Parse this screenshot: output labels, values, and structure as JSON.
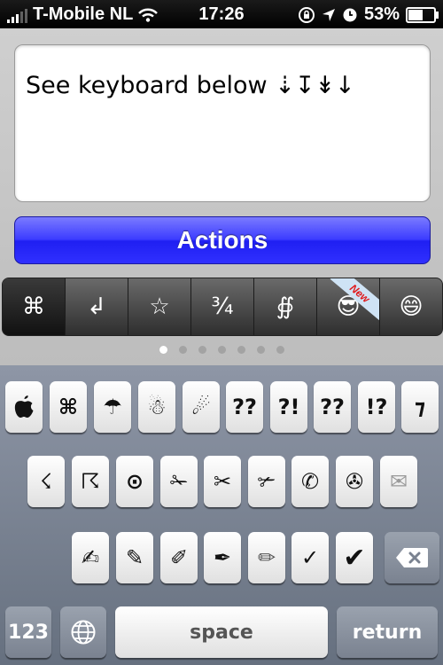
{
  "status_bar": {
    "carrier": "T-Mobile NL",
    "time": "17:26",
    "battery_percent": "53%",
    "battery_level": 0.53
  },
  "text_field": {
    "value": "See keyboard below ⇣↧↡↓"
  },
  "actions_button": {
    "label": "Actions"
  },
  "category_tabs": [
    {
      "symbol": "⌘",
      "icon": "command-icon"
    },
    {
      "symbol": "↲",
      "icon": "return-arrow-icon"
    },
    {
      "symbol": "☆",
      "icon": "star-icon"
    },
    {
      "symbol": "¾",
      "icon": "fraction-icon"
    },
    {
      "symbol": "∯",
      "icon": "integral-icon"
    },
    {
      "symbol": "😎",
      "icon": "sunglasses-face-icon",
      "badge": "New"
    },
    {
      "symbol": "😄",
      "icon": "smiley-icon"
    }
  ],
  "page_dots": {
    "count": 7,
    "current": 1
  },
  "keyboard": {
    "row1": [
      "",
      "⌘",
      "☂",
      "☃",
      "☄",
      "??",
      "?!",
      "??",
      "!?",
      "⁊"
    ],
    "row1_icons": [
      "apple-icon",
      "command-key-icon",
      "umbrella-icon",
      "snowman-icon",
      "comet-icon",
      "double-question-key",
      "interrobang-key",
      "double-question-key-2",
      "exclamation-question-key",
      "tironian-et-key"
    ],
    "row2": [
      "☇",
      "☈",
      "⊙",
      "✁",
      "✂",
      "✃",
      "✆",
      "✇",
      "✉"
    ],
    "row2_icons": [
      "lightning-icon",
      "thunderstorm-icon",
      "circled-dot-icon",
      "scissors-icon",
      "scissors-icon-2",
      "scissors-icon-3",
      "telephone-icon",
      "tape-drive-icon",
      "envelope-icon"
    ],
    "row3": [
      "✍",
      "✎",
      "✐",
      "✒",
      "✏",
      "✓",
      "✔"
    ],
    "row3_icons": [
      "writing-hand-icon",
      "pencil-icon",
      "pencil-upright-icon",
      "nib-icon",
      "pen-icon",
      "check-icon",
      "heavy-check-icon"
    ],
    "bottom": {
      "numbers": "123",
      "space": "space",
      "return": "return"
    }
  },
  "colors": {
    "actions_button": "#3c3cff",
    "tab_bar": "#3a3a3a",
    "badge_text": "#e0191b"
  }
}
